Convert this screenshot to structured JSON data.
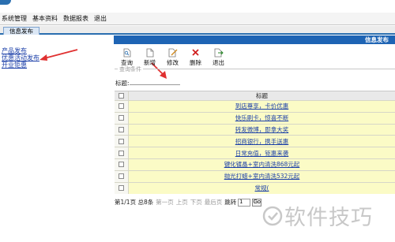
{
  "menubar": {
    "items": [
      "系统管理",
      "基本资料",
      "数据报表",
      "退出"
    ]
  },
  "tab": {
    "label": "信息发布"
  },
  "panel": {
    "title": "信息发布"
  },
  "sidebar": {
    "links": [
      "产品发布",
      "优惠活动发布",
      "开业钜惠"
    ]
  },
  "toolbar": {
    "buttons": [
      "查询",
      "新增",
      "修改",
      "删除",
      "退出"
    ]
  },
  "query": {
    "legend": "查询条件",
    "label": "标题:",
    "value": ""
  },
  "grid": {
    "header": "标题",
    "rows": [
      "到店尊享，卡价优惠",
      "快乐刷卡，惊喜不断",
      "转发微博，即拿大奖",
      "招商银行，携手送惠",
      "日常充值，钜惠来袭",
      "键化镀晶+室内清洗868元起",
      "抛光打蜡+室内清洗532元起",
      "常规("
    ]
  },
  "pager": {
    "summary": "第1/1页 总8条",
    "first": "第一页",
    "prev": "上页",
    "next": "下页",
    "last": "最后页",
    "jump_label": "跳转",
    "page_value": "1",
    "go_label": "Go"
  },
  "watermark": {
    "text": "软件技巧"
  },
  "colors": {
    "title_bar": "#1e64b4",
    "row_highlight": "#fbfbc6",
    "link": "#1a3ea8",
    "arrow": "#e03030"
  }
}
